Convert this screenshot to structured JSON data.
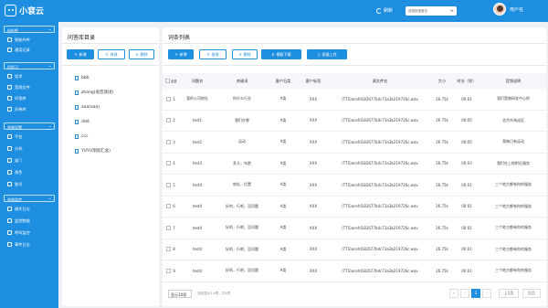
{
  "app": {
    "title": "小袞云"
  },
  "topbar": {
    "refresh_label": "刷新",
    "select_placeholder": "请选择语音包",
    "user_name": "用户名"
  },
  "sidebar": {
    "groups": [
      {
        "label": "AI外呼",
        "items": [
          "智能外呼",
          "通话记录"
        ]
      },
      {
        "label": "AI学习",
        "items": [
          "话术",
          "音频文件",
          "问答库",
          "问卷库"
        ]
      },
      {
        "label": "系统设置",
        "items": [
          "平台",
          "分机",
          "部门",
          "角色",
          "账号"
        ]
      },
      {
        "label": "系统监控",
        "items": [
          "操作日志",
          "监控数据",
          "呼叫监控",
          "事件日志"
        ]
      }
    ]
  },
  "left_panel": {
    "title": "问答库目录",
    "buttons": {
      "add": "新增",
      "edit": "修改",
      "delete": "删除"
    },
    "items": [
      "bbb",
      "zhang(语音测试)",
      "aaa(aaa)",
      "ddd",
      "ccc",
      "YUYU测验汇总)"
    ]
  },
  "right_panel": {
    "title": "词条列表",
    "buttons": {
      "add": "新增",
      "edit": "修改",
      "delete": "删除",
      "template": "模板下载",
      "upload": "批量上传"
    },
    "columns": [
      "全选",
      "问题名",
      "关键词",
      "客户归类",
      "客户标签",
      "源文件名",
      "大小",
      "时长（秒）",
      "音频说明"
    ],
    "rows": [
      [
        "1",
        "我的公司地址",
        "你什么行业",
        "A类",
        "XXX",
        "(TTS)acefd182677b4c73a3b219726c.wav",
        "26.75k",
        "00:01",
        "我们是做研发中心的"
      ],
      [
        "2",
        "test1",
        "我们在哪",
        "A类",
        "XXX",
        "(TTS)acefd182677b4c73a3b219726c.wav",
        "26.75k",
        "00:05",
        "北京市海淀区"
      ],
      [
        "3",
        "test2",
        "运动",
        "A类",
        "XXX",
        "(TTS)acefd182677b4c73a3b219726c.wav",
        "26.75k",
        "00:05",
        "我每日有运动"
      ],
      [
        "4",
        "test3",
        "多大，年龄",
        "A类",
        "XXX",
        "(TTS)acefd182677b4c73a3b219726c.wav",
        "26.75k",
        "00:03",
        "我们在上地附近服务"
      ],
      [
        "5",
        "test4",
        "地址，位置",
        "A类",
        "XXX",
        "(TTS)acefd182677b4c73a3b219726c.wav",
        "26.75k",
        "00:01",
        "三个地方都有你的服务"
      ],
      [
        "6",
        "test4",
        "好的，行吧，没问题",
        "A类",
        "XXX",
        "(TTS)acefd182677b4c73a3b219726c.wav",
        "26.75k",
        "00:01",
        "三个地方都有你的服务"
      ],
      [
        "7",
        "test4",
        "好的，行吧，没问题",
        "A类",
        "XXX",
        "(TTS)acefd182677b4c73a3b219726c.wav",
        "26.75k",
        "00:01",
        "三个地方都有你的服务"
      ],
      [
        "8",
        "test4",
        "好的，行吧，没问题",
        "A类",
        "XXX",
        "(TTS)acefd182677b4c73a3b219726c.wav",
        "26.75k",
        "00:01",
        "三个地方都有你的服务"
      ],
      [
        "9",
        "test4",
        "好的，行吧，没问题",
        "A类",
        "XXX",
        "(TTS)acefd182677b4c73a3b219726c.wav",
        "26.75k",
        "00:01",
        "三个地方都有你的服务"
      ]
    ],
    "footer": {
      "page_size": "显示10项",
      "info": "当前显示1-9项，共9项",
      "current_page": "1",
      "prev_label": "上1页",
      "next_label": "后页"
    }
  },
  "colors": {
    "primary": "#1e8fe0"
  }
}
